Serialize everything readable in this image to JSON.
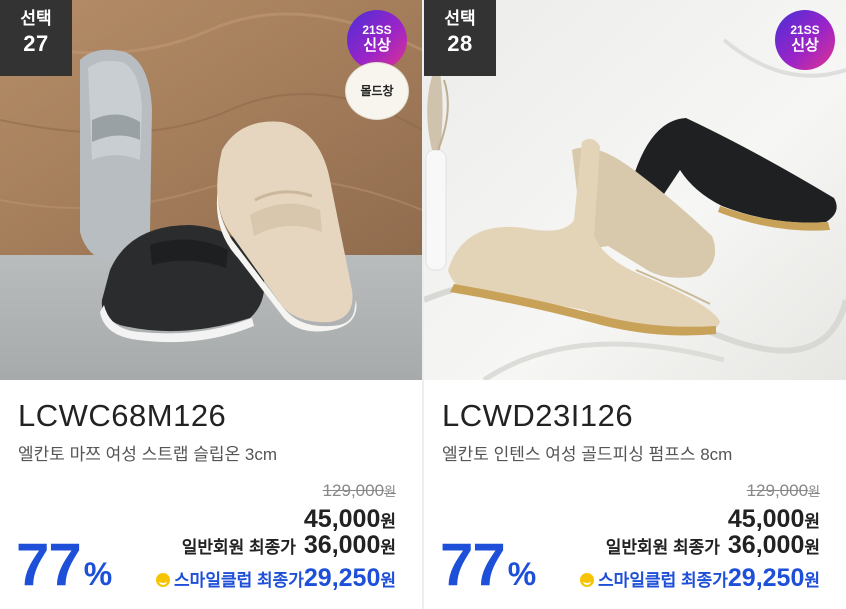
{
  "products": [
    {
      "select_label": "선택",
      "select_number": "27",
      "new_badge": {
        "line1": "21SS",
        "line2": "신상"
      },
      "mold_badge": "몰드창",
      "code": "LCWC68M126",
      "name": "엘칸토 마쯔 여성 스트랩 슬립온 3cm",
      "original_price": "129,000",
      "sale_price": "45,000",
      "member_label": "일반회원 최종가",
      "member_price": "36,000",
      "smile_label": "스마일클럽 최종가",
      "smile_price": "29,250",
      "currency": "원",
      "discount": "77",
      "discount_unit": "%",
      "image": "loafer-slipon-shoes-photo"
    },
    {
      "select_label": "선택",
      "select_number": "28",
      "new_badge": {
        "line1": "21SS",
        "line2": "신상"
      },
      "code": "LCWD23I126",
      "name": "엘칸토 인텐스 여성 골드피싱 펌프스 8cm",
      "original_price": "129,000",
      "sale_price": "45,000",
      "member_label": "일반회원 최종가",
      "member_price": "36,000",
      "smile_label": "스마일클럽 최종가",
      "smile_price": "29,250",
      "currency": "원",
      "discount": "77",
      "discount_unit": "%",
      "image": "pointed-pumps-heels-photo"
    }
  ],
  "colors": {
    "accent_blue": "#1e4fd8",
    "badge_dark": "#333333",
    "new_badge_gradient": [
      "#4a2fd6",
      "#e0338f"
    ],
    "smile_icon": "#f6c500"
  }
}
